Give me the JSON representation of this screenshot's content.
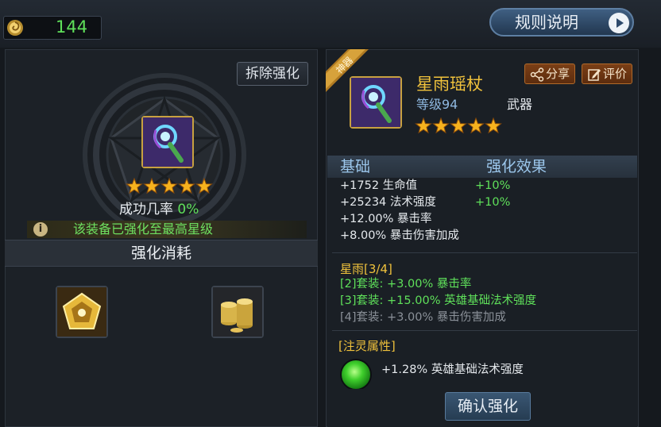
{
  "topbar": {
    "currency_icon": "spiral-gem-icon",
    "currency_amount": "144",
    "rules_label": "规则说明"
  },
  "left": {
    "remove_label": "拆除强化",
    "stars": 5,
    "success_label": "成功几率",
    "success_value": "0%",
    "maxed_notice": "该装备已强化至最高星级",
    "cost_title": "强化消耗",
    "materials": [
      "enhance-stone-icon",
      "gold-coins-icon"
    ]
  },
  "right": {
    "ribbon": "神器",
    "item_name": "星雨瑶杖",
    "item_level": "等级94",
    "item_type": "武器",
    "stars": 5,
    "share_label": "分享",
    "rate_label": "评价",
    "header_base": "基础",
    "header_effect": "强化效果",
    "stats": [
      {
        "text": "+1752 生命值",
        "bonus": "+10%"
      },
      {
        "text": "+25234 法术强度",
        "bonus": "+10%"
      },
      {
        "text": "+12.00% 暴击率",
        "bonus": ""
      },
      {
        "text": "+8.00% 暴击伤害加成",
        "bonus": ""
      }
    ],
    "set_title": "星雨[3/4]",
    "set_bonuses": [
      {
        "text": "[2]套装: +3.00% 暴击率",
        "active": true
      },
      {
        "text": "[3]套装: +15.00% 英雄基础法术强度",
        "active": true
      },
      {
        "text": "[4]套装: +3.00% 暴击伤害加成",
        "active": false
      }
    ],
    "spirit_title": "[注灵属性]",
    "spirit_text": "+1.28% 英雄基础法术强度",
    "confirm_label": "确认强化"
  },
  "colors": {
    "gold": "#f0c23c",
    "green": "#5fe05a",
    "blue_label": "#9cc7ec",
    "inactive": "#8a9098"
  }
}
